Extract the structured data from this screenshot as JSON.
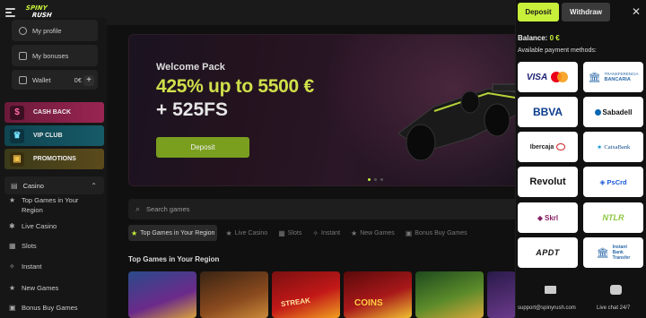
{
  "logo": {
    "line1": "SPINY",
    "line2": "RUSH"
  },
  "account": {
    "profile": "My profile",
    "bonuses": "My bonuses",
    "wallet": "Wallet",
    "wallet_amount": "0€"
  },
  "promos": {
    "cashback": "CASH BACK",
    "vip": "VIP CLUB",
    "promotions": "PROMOTIONS"
  },
  "nav": {
    "casino": "Casino",
    "items": [
      "Top Games in Your Region",
      "Live Casino",
      "Slots",
      "Instant",
      "New Games",
      "Bonus Buy Games"
    ],
    "top_line1": "Top Games in Your",
    "top_line2": "Region"
  },
  "hero": {
    "subtitle": "Welcome Pack",
    "line1_a": "425% up to ",
    "line1_b": "5500 €",
    "line2": "+ 525FS",
    "cta": "Deposit"
  },
  "search": {
    "placeholder": "Search games"
  },
  "tabs": [
    "Top Games in Your Region",
    "Live Casino",
    "Slots",
    "Instant",
    "New Games",
    "Bonus Buy Games"
  ],
  "section_title": "Top Games in Your Region",
  "thumb_texts": [
    "STREAK",
    "COINS"
  ],
  "panel": {
    "deposit": "Deposit",
    "withdraw": "Withdraw",
    "balance_label": "Balance: ",
    "balance_value": "0 €",
    "methods_label": "Available payment methods:",
    "methods": {
      "visa": "VISA",
      "transfer_top": "TRANSFERENCIA",
      "transfer_bottom": "BANCARIA",
      "bbva": "BBVA",
      "sabadell": "Sabadell",
      "ibercaja": "Ibercaja",
      "caixabank": "CaixaBank",
      "revolut": "Revolut",
      "pscrd": "PsCrd",
      "skrl": "Skrl",
      "ntlr": "NTLR",
      "apdt": "APDT",
      "instant1": "Instant",
      "instant2": "Bank",
      "instant3": "Transfer"
    },
    "support_email": "support@spinyrush.com",
    "live_chat": "Live chat 24/7"
  }
}
